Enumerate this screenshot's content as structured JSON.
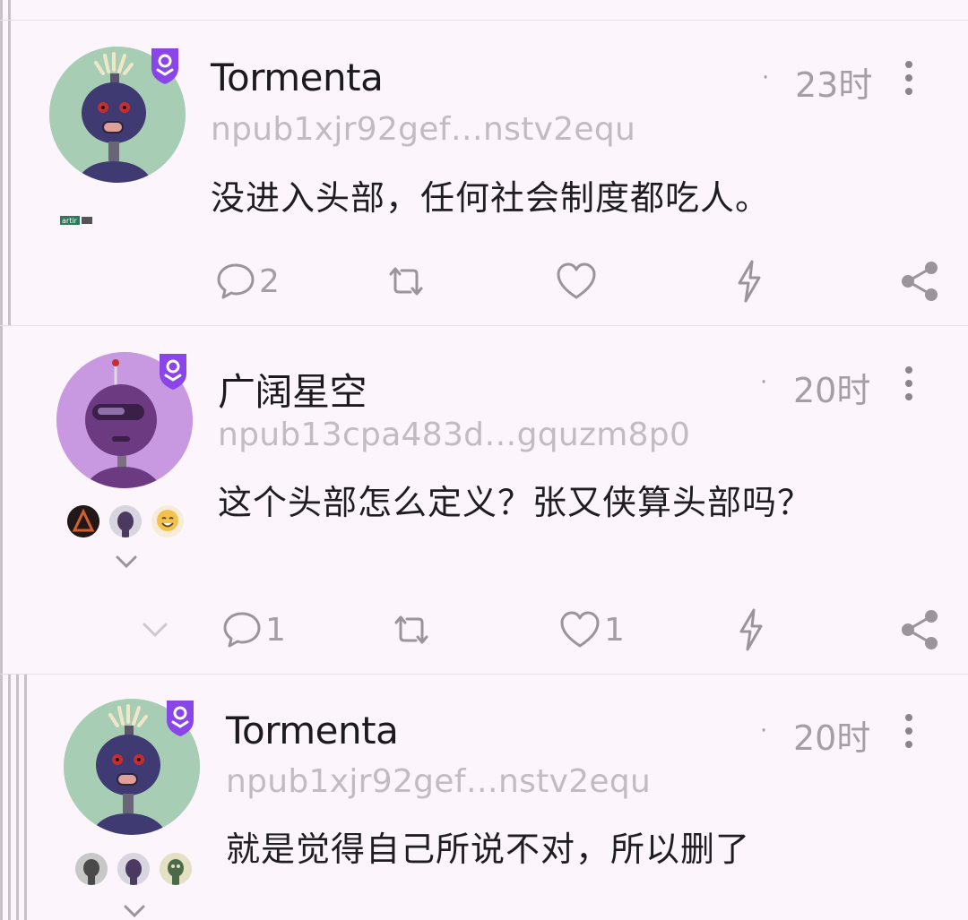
{
  "posts": [
    {
      "author": "Tormenta",
      "npub": "npub1xjr92gef…nstv2equ",
      "time": "23时",
      "dot": "·",
      "content": "没进入头部，任何社会制度都吃人。",
      "replies": "2",
      "reposts": "",
      "likes": "",
      "avatar_bg": "#a8cdb5",
      "tag_text": "artir"
    },
    {
      "author": "广阔星空",
      "npub": "npub13cpa483d…gquzm8p0",
      "time": "20时",
      "dot": "·",
      "content": "这个头部怎么定义？张又侠算头部吗？",
      "replies": "1",
      "reposts": "",
      "likes": "1",
      "avatar_bg": "#c898e0"
    },
    {
      "author": "Tormenta",
      "npub": "npub1xjr92gef…nstv2equ",
      "time": "20时",
      "dot": "·",
      "content": "就是觉得自己所说不对，所以删了",
      "avatar_bg": "#a8cdb5"
    }
  ],
  "colors": {
    "background": "#fcf6fc",
    "badge": "#8a45e8",
    "muted": "#a59fa5",
    "icon": "#9b959b"
  },
  "icons": [
    "verified-badge-icon",
    "reply-icon",
    "repost-icon",
    "like-icon",
    "zap-icon",
    "share-icon",
    "more-icon",
    "chevron-down-icon"
  ]
}
